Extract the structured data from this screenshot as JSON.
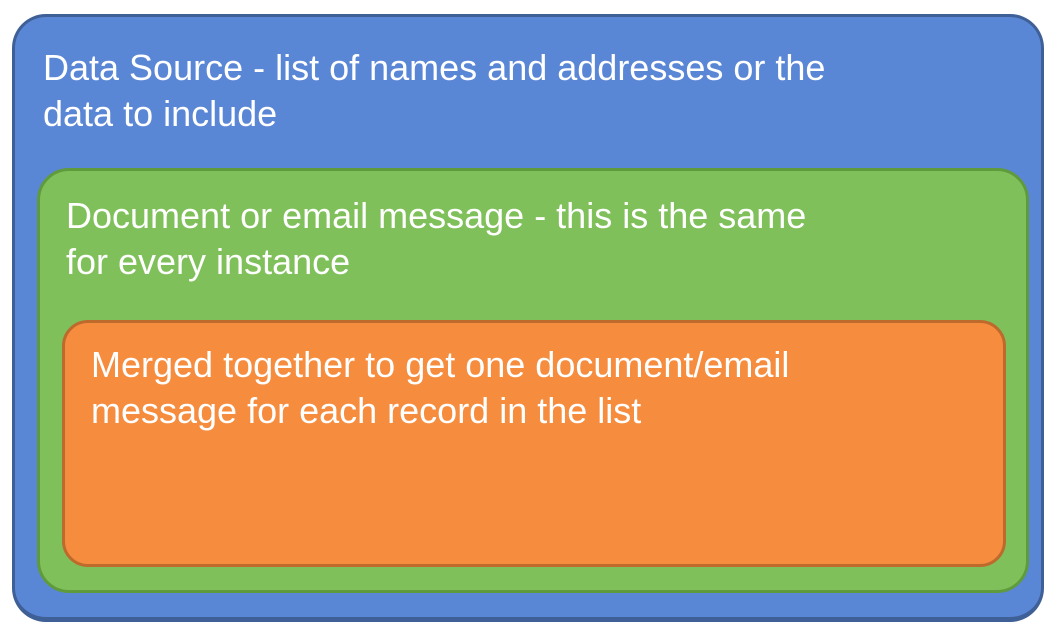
{
  "colors": {
    "data_source_fill": "#5a86d6",
    "document_fill": "#7fc05a",
    "merged_fill": "#f68c3e",
    "text": "#ffffff"
  },
  "boxes": {
    "data_source": {
      "label": "Data Source - list of names and addresses or the\ndata to include"
    },
    "document": {
      "label": "Document or email message - this is the same\nfor every instance"
    },
    "merged": {
      "label": "Merged together to get one document/email\nmessage for each record in the list"
    }
  }
}
